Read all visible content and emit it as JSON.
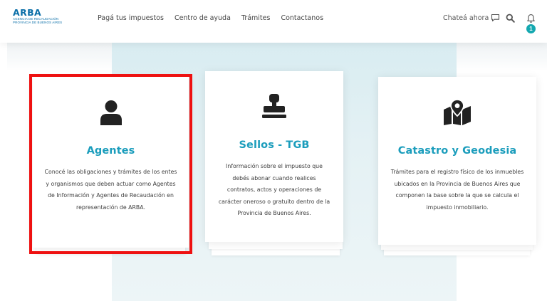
{
  "header": {
    "logo": {
      "main": "ARBA",
      "line1": "AGENCIA DE RECAUDACIÓN",
      "line2": "PROVINCIA DE BUENOS AIRES"
    },
    "nav": [
      "Pagá tus impuestos",
      "Centro de ayuda",
      "Trámites",
      "Contactanos"
    ],
    "chat_label": "Chateá ahora",
    "notification_count": "1"
  },
  "cards": [
    {
      "title": "Agentes",
      "icon": "user-icon",
      "description": "Conocé las obligaciones y trámites de los entes y organismos que deben actuar como Agentes de Información y Agentes de Recaudación en representación de ARBA."
    },
    {
      "title": "Sellos - TGB",
      "icon": "stamp-icon",
      "description": "Información sobre el impuesto que debés abonar cuando realices contratos, actos y operaciones de carácter oneroso o gratuito dentro de la Provincia de Buenos Aires."
    },
    {
      "title": "Catastro y Geodesia",
      "icon": "map-location-icon",
      "description": "Trámites para el registro físico de los inmuebles ubicados en la Provincia de Buenos Aires que componen la base sobre la que se calcula el impuesto inmobiliario."
    }
  ],
  "colors": {
    "brand": "#0b6fa8",
    "accent": "#1b9dbc",
    "badge": "#14a8b0",
    "highlight": "#ee1111"
  }
}
